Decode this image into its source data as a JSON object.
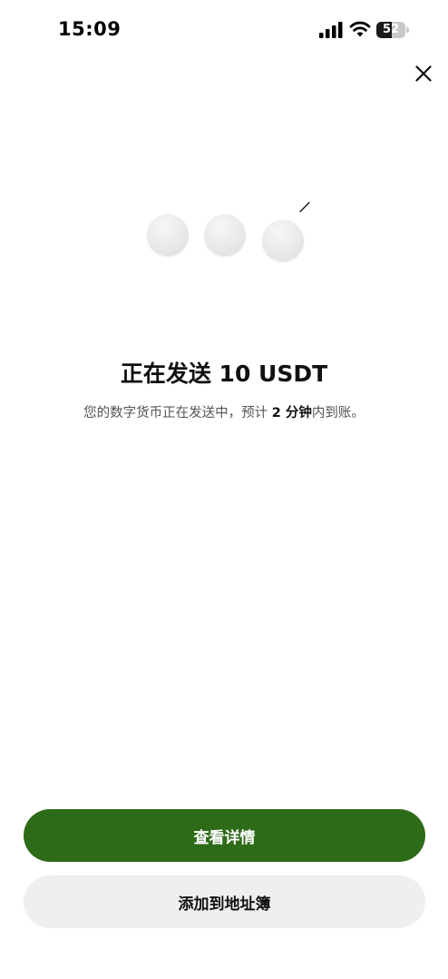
{
  "status_bar": {
    "time": "15:09",
    "battery_level": "52",
    "battery_fraction": 0.52,
    "icons": [
      "signal-icon",
      "wifi-icon",
      "battery-icon"
    ]
  },
  "header": {
    "close_icon": "close-icon"
  },
  "loader": {
    "dots": 3,
    "icon": "spark-icon"
  },
  "main": {
    "title": "正在发送 10 USDT",
    "subtitle_prefix": "您的数字货币正在发送中，预计 ",
    "subtitle_time": "2 分钟",
    "subtitle_suffix": "内到账。"
  },
  "actions": {
    "view_details_label": "查看详情",
    "add_to_address_book_label": "添加到地址簿"
  },
  "colors": {
    "primary": "#2e6b19",
    "secondary_bg": "#efefef",
    "text": "#111111",
    "subtext": "#555555"
  }
}
